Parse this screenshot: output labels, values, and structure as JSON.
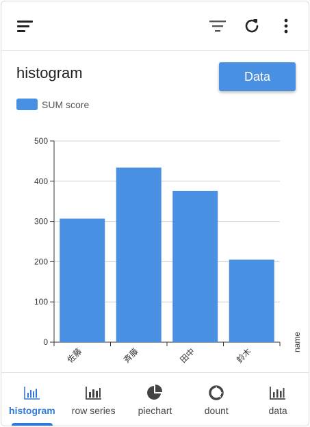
{
  "header": {
    "menu_icon": "menu-icon",
    "filter_icon": "filter-icon",
    "refresh_icon": "refresh-icon",
    "more_icon": "more-vert-icon"
  },
  "main": {
    "title": "histogram",
    "data_button": "Data",
    "accent_color": "#4a90e2"
  },
  "chart_data": {
    "type": "bar",
    "categories": [
      "佐藤",
      "斉藤",
      "田中",
      "鈴木"
    ],
    "series": [
      {
        "name": "SUM score",
        "values": [
          307,
          434,
          376,
          205
        ]
      }
    ],
    "xlabel": "name",
    "ylabel": "",
    "ylim": [
      0,
      500
    ],
    "yticks": [
      0,
      100,
      200,
      300,
      400,
      500
    ],
    "grid": true,
    "legend": "top-left"
  },
  "bottom_nav": {
    "items": [
      {
        "label": "histogram",
        "icon": "bar-chart-icon",
        "active": true
      },
      {
        "label": "row series",
        "icon": "bar-chart-icon",
        "active": false
      },
      {
        "label": "piechart",
        "icon": "pie-chart-icon",
        "active": false
      },
      {
        "label": "dount",
        "icon": "donut-chart-icon",
        "active": false
      },
      {
        "label": "data",
        "icon": "bar-chart-icon",
        "active": false
      }
    ]
  }
}
